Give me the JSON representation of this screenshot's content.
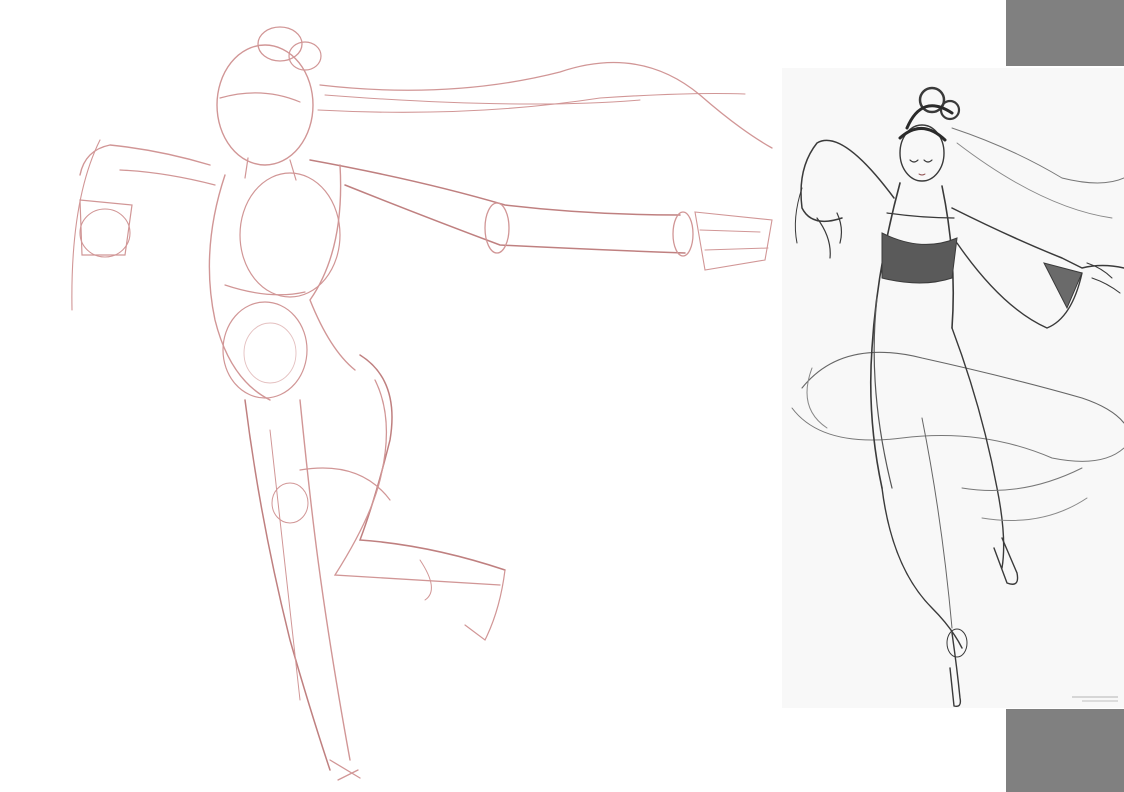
{
  "colors": {
    "background": "#ffffff",
    "sketch_stroke": "#c98484",
    "sketch_stroke_dark": "#b56a6a",
    "reference_panel": "#f8f8f8",
    "reference_ink": "#3a3a3a",
    "reference_shade": "#6a6a6a",
    "side_block": "#808080"
  },
  "elements": {
    "sketch": "pose-construction-sketch",
    "reference": "dancer-reference-drawing",
    "side_blocks": [
      "gray-block-top",
      "gray-block-bottom"
    ]
  }
}
